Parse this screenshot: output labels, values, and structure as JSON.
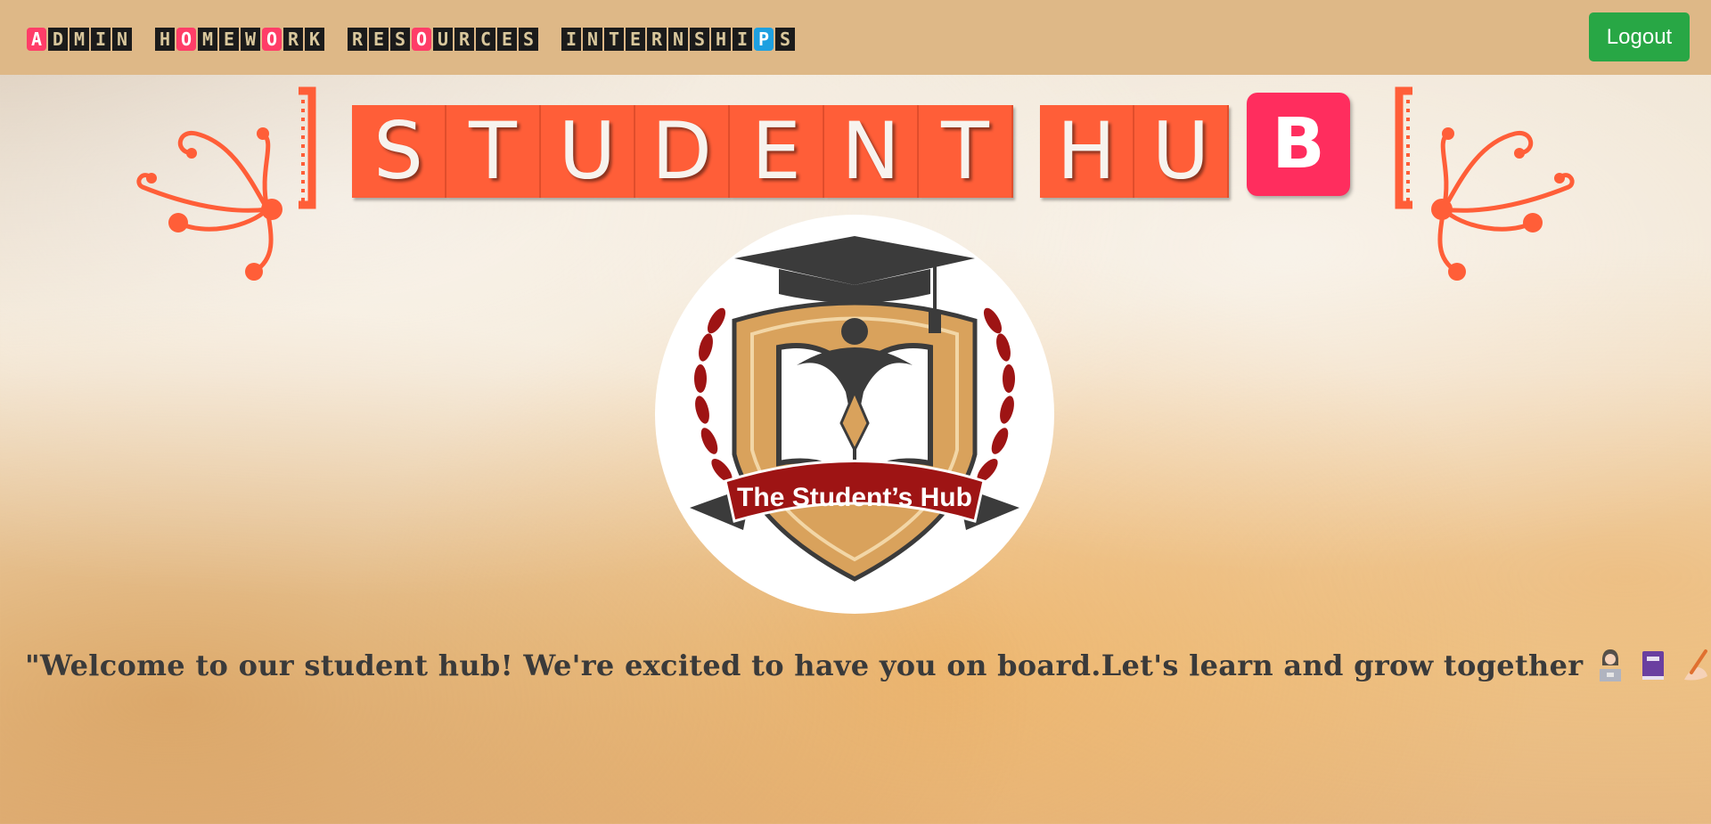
{
  "nav": {
    "items": [
      {
        "label": "ADMIN",
        "tiles": [
          {
            "c": "A",
            "style": "pink"
          },
          {
            "c": "D"
          },
          {
            "c": "M"
          },
          {
            "c": "I"
          },
          {
            "c": "N"
          }
        ]
      },
      {
        "label": "HOMEWORK",
        "tiles": [
          {
            "c": "H"
          },
          {
            "c": "O",
            "style": "pink"
          },
          {
            "c": "M"
          },
          {
            "c": "E"
          },
          {
            "c": "W"
          },
          {
            "c": "O",
            "style": "pink"
          },
          {
            "c": "R"
          },
          {
            "c": "K"
          }
        ]
      },
      {
        "label": "RESOURCES",
        "tiles": [
          {
            "c": "R"
          },
          {
            "c": "E"
          },
          {
            "c": "S"
          },
          {
            "c": "O",
            "style": "pink"
          },
          {
            "c": "U"
          },
          {
            "c": "R"
          },
          {
            "c": "C"
          },
          {
            "c": "E"
          },
          {
            "c": "S"
          }
        ]
      },
      {
        "label": "INTERNSHIPS",
        "tiles": [
          {
            "c": "I"
          },
          {
            "c": "N"
          },
          {
            "c": "T"
          },
          {
            "c": "E"
          },
          {
            "c": "R"
          },
          {
            "c": "N"
          },
          {
            "c": "S"
          },
          {
            "c": "H"
          },
          {
            "c": "I"
          },
          {
            "c": "P",
            "style": "blue"
          },
          {
            "c": "S"
          }
        ]
      }
    ],
    "logout_label": "Logout"
  },
  "banner": {
    "word1": [
      "S",
      "T",
      "U",
      "D",
      "E",
      "N",
      "T"
    ],
    "word2": [
      "H",
      "U"
    ],
    "accent_letter": "B"
  },
  "logo": {
    "text": "The Student’s Hub"
  },
  "welcome": {
    "text": "\"Welcome to our student hub! We're excited to have you on board.Let's learn and grow together",
    "emojis": [
      "woman-at-laptop-icon",
      "book-icon",
      "writing-hand-icon"
    ]
  },
  "colors": {
    "navbar": "#deb887",
    "accent_orange": "#ff5e38",
    "accent_pink": "#ff2d5e",
    "logout_green": "#28a745",
    "nav_tile_blue": "#1ea0e0"
  }
}
